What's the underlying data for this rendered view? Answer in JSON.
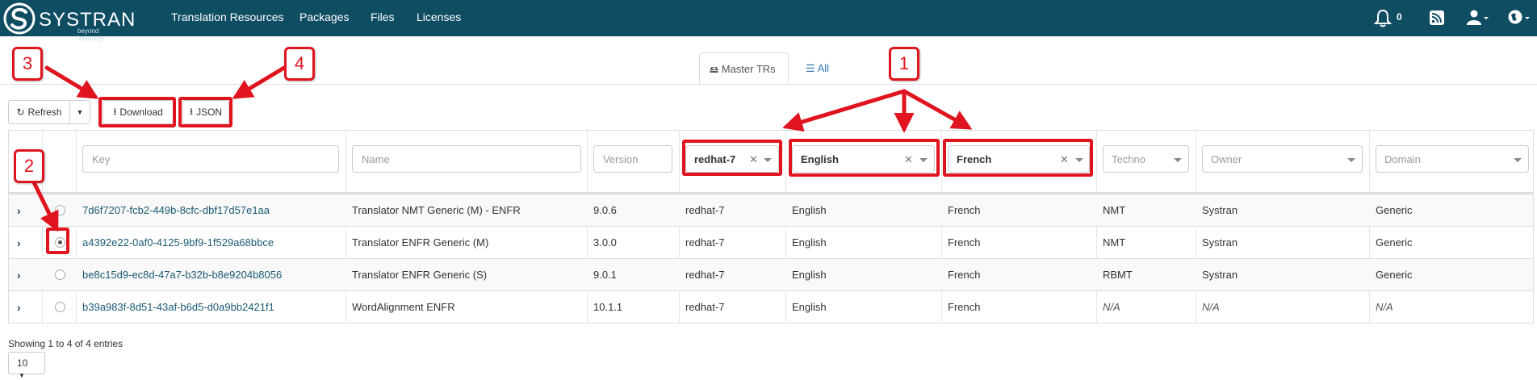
{
  "colors": {
    "navbar": "#0f4d63",
    "link": "#1a5a74",
    "annotation": "#e0141e"
  },
  "brand": {
    "name": "SYSTRAN",
    "tagline": "beyond language"
  },
  "nav": {
    "links": [
      "Translation Resources",
      "Packages",
      "Files",
      "Licenses"
    ],
    "notification_count": "0",
    "icons": [
      "bell-icon",
      "rss-icon",
      "user-icon",
      "globe-icon"
    ]
  },
  "tabs": [
    {
      "label": "Master TRs",
      "icon": "hdd-icon",
      "active": true
    },
    {
      "label": "All",
      "icon": "list-icon",
      "active": false
    }
  ],
  "toolbar": {
    "refresh_label": "Refresh",
    "download_label": "Download",
    "json_label": "JSON"
  },
  "filters": {
    "key_placeholder": "Key",
    "name_placeholder": "Name",
    "version_placeholder": "Version",
    "platform_value": "redhat-7",
    "source_value": "English",
    "target_value": "French",
    "techno_placeholder": "Techno",
    "owner_placeholder": "Owner",
    "domain_placeholder": "Domain"
  },
  "rows": [
    {
      "key": "7d6f7207-fcb2-449b-8cfc-dbf17d57e1aa",
      "name": "Translator NMT Generic (M) - ENFR",
      "version": "9.0.6",
      "platform": "redhat-7",
      "source": "English",
      "target": "French",
      "techno": "NMT",
      "owner": "Systran",
      "domain": "Generic",
      "selected": false
    },
    {
      "key": "a4392e22-0af0-4125-9bf9-1f529a68bbce",
      "name": "Translator ENFR Generic (M)",
      "version": "3.0.0",
      "platform": "redhat-7",
      "source": "English",
      "target": "French",
      "techno": "NMT",
      "owner": "Systran",
      "domain": "Generic",
      "selected": true
    },
    {
      "key": "be8c15d9-ec8d-47a7-b32b-b8e9204b8056",
      "name": "Translator ENFR Generic (S)",
      "version": "9.0.1",
      "platform": "redhat-7",
      "source": "English",
      "target": "French",
      "techno": "RBMT",
      "owner": "Systran",
      "domain": "Generic",
      "selected": false
    },
    {
      "key": "b39a983f-8d51-43af-b6d5-d0a9bb2421f1",
      "name": "WordAlignment ENFR",
      "version": "10.1.1",
      "platform": "redhat-7",
      "source": "English",
      "target": "French",
      "techno": "N/A",
      "owner": "N/A",
      "domain": "N/A",
      "selected": false
    }
  ],
  "footer": {
    "info": "Showing 1 to 4 of 4 entries",
    "page_size": "10"
  },
  "annotations": {
    "n1": "1",
    "n2": "2",
    "n3": "3",
    "n4": "4"
  }
}
